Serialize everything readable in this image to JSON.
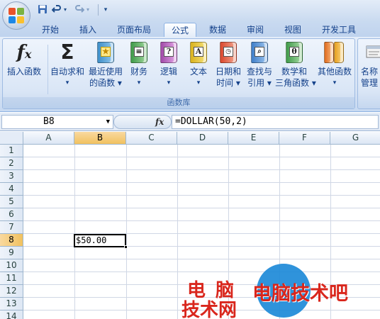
{
  "tabs": [
    "开始",
    "插入",
    "页面布局",
    "公式",
    "数据",
    "审阅",
    "视图",
    "开发工具"
  ],
  "active_tab": "公式",
  "ribbon": {
    "insert_function": "插入函数",
    "autosum": [
      "自动求和",
      "▾"
    ],
    "recent": [
      "最近使用",
      "的函数 ▾"
    ],
    "financial": [
      "财务",
      "▾"
    ],
    "logical": [
      "逻辑",
      "▾"
    ],
    "text": [
      "文本",
      "▾"
    ],
    "datetime": [
      "日期和",
      "时间 ▾"
    ],
    "lookup": [
      "查找与",
      "引用 ▾"
    ],
    "math": [
      "数学和",
      "三角函数 ▾"
    ],
    "more": [
      "其他函数",
      "▾"
    ],
    "group_label": "函数库",
    "name_manager": [
      "名称",
      "管理"
    ]
  },
  "formula_bar": {
    "name_box": "B8",
    "fx": "fx",
    "formula": "=DOLLAR(50,2)"
  },
  "columns": [
    "A",
    "B",
    "C",
    "D",
    "E",
    "F",
    "G"
  ],
  "selected_column": "B",
  "rows": [
    "1",
    "2",
    "3",
    "4",
    "5",
    "6",
    "7",
    "8",
    "9",
    "10",
    "11",
    "12",
    "13",
    "14"
  ],
  "selected_row": "8",
  "cells": {
    "B8": "$50.00"
  },
  "watermark": {
    "left_line1": "电脑",
    "left_line2": "技术网",
    "right": "电脑技术吧"
  },
  "colors": {
    "ribbon_bg": "#d6e3f5",
    "selection_header": "#f1c15f",
    "watermark_red": "#d9261c",
    "watermark_blue": "#1d8ad8"
  },
  "icons": [
    "office-button-icon",
    "save-icon",
    "undo-icon",
    "redo-icon",
    "customize-icon",
    "fx-icon",
    "sigma-icon",
    "book-icon",
    "name-manager-icon"
  ]
}
